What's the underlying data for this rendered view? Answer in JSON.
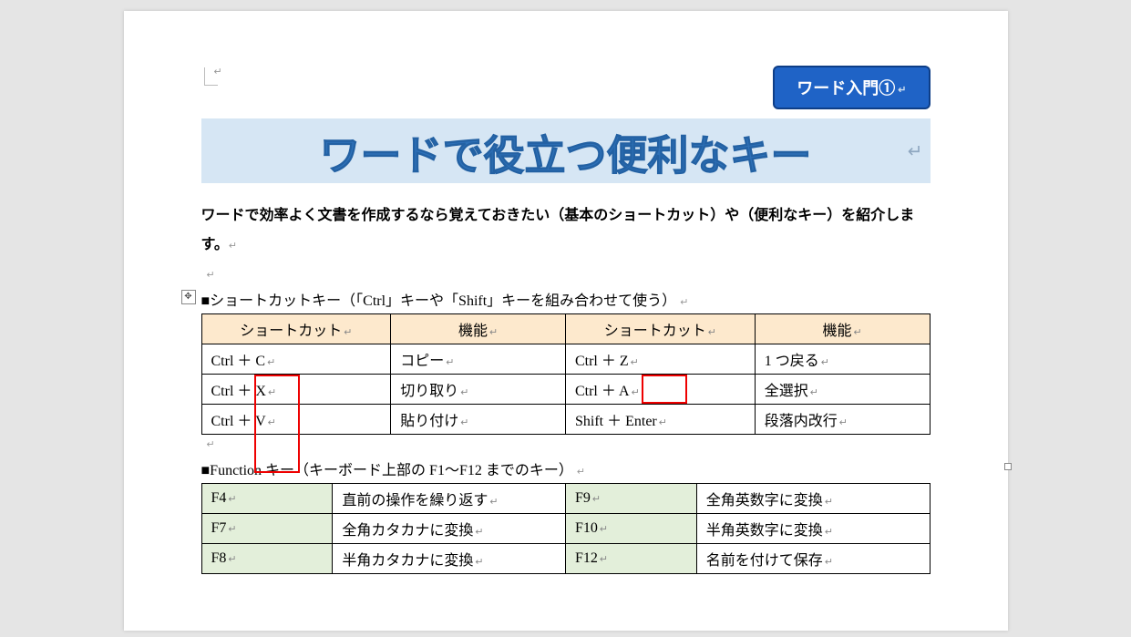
{
  "badge": {
    "text": "ワード入門①"
  },
  "title": "ワードで役立つ便利なキー",
  "intro": "ワードで効率よく文書を作成するなら覚えておきたい（基本のショートカット）や（便利なキー）を紹介します。",
  "section1": {
    "heading": "■ショートカットキー（「Ctrl」キーや「Shift」キーを組み合わせて使う）",
    "headers": [
      "ショートカット",
      "機能",
      "ショートカット",
      "機能"
    ],
    "rows": [
      [
        "Ctrl ＋ C",
        "コピー",
        "Ctrl ＋ Z",
        "1 つ戻る"
      ],
      [
        "Ctrl ＋ X",
        "切り取り",
        "Ctrl ＋ A",
        "全選択"
      ],
      [
        "Ctrl ＋ V",
        "貼り付け",
        "Shift ＋ Enter",
        "段落内改行"
      ]
    ]
  },
  "section2": {
    "heading": "■Function キー（キーボード上部の F1～F12 までのキー）",
    "rows": [
      [
        "F4",
        "直前の操作を繰り返す",
        "F9",
        "全角英数字に変換"
      ],
      [
        "F7",
        "全角カタカナに変換",
        "F10",
        "半角英数字に変換"
      ],
      [
        "F8",
        "半角カタカナに変換",
        "F12",
        "名前を付けて保存"
      ]
    ]
  },
  "marks": {
    "para": "↵",
    "cell": "↵"
  }
}
